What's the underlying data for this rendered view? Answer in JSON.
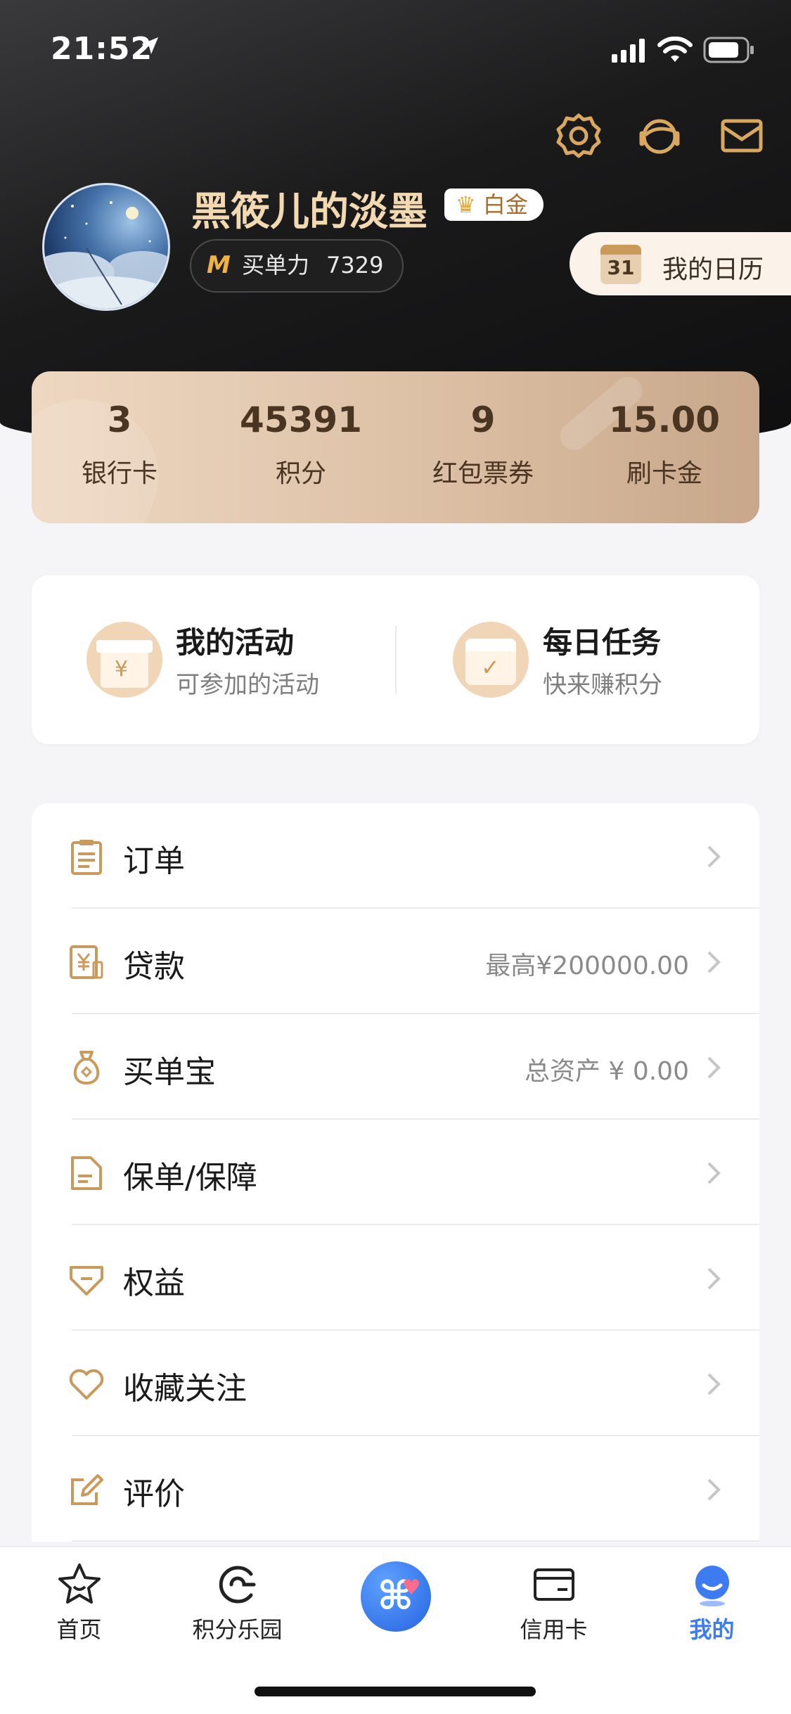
{
  "status_bar": {
    "time": "21:52"
  },
  "header": {
    "username": "黑筱儿的淡墨",
    "level_badge": "白金",
    "score_label": "买单力",
    "score_value": "7329",
    "calendar_day": "31",
    "calendar_label": "我的日历"
  },
  "stats": [
    {
      "value": "3",
      "label": "银行卡"
    },
    {
      "value": "45391",
      "label": "积分"
    },
    {
      "value": "9",
      "label": "红包票券"
    },
    {
      "value": "15.00",
      "label": "刷卡金"
    }
  ],
  "activity": {
    "left": {
      "title": "我的活动",
      "subtitle": "可参加的活动"
    },
    "right": {
      "title": "每日任务",
      "subtitle": "快来赚积分"
    }
  },
  "menu": [
    {
      "label": "订单",
      "value": "",
      "icon": "order-icon"
    },
    {
      "label": "贷款",
      "value": "最高¥200000.00",
      "icon": "loan-icon"
    },
    {
      "label": "买单宝",
      "value": "总资产 ¥ 0.00",
      "icon": "money-bag-icon"
    },
    {
      "label": "保单/保障",
      "value": "",
      "icon": "policy-icon"
    },
    {
      "label": "权益",
      "value": "",
      "icon": "diamond-icon"
    },
    {
      "label": "收藏关注",
      "value": "",
      "icon": "heart-icon"
    },
    {
      "label": "评价",
      "value": "",
      "icon": "edit-icon"
    }
  ],
  "tabs": [
    {
      "label": "首页",
      "icon": "star-icon",
      "active": false
    },
    {
      "label": "积分乐园",
      "icon": "points-icon",
      "active": false
    },
    {
      "label": "",
      "icon": "center-logo-icon",
      "active": false
    },
    {
      "label": "信用卡",
      "icon": "card-icon",
      "active": false
    },
    {
      "label": "我的",
      "icon": "profile-icon",
      "active": true
    }
  ],
  "colors": {
    "accent_gold": "#c99a5b",
    "active_tab": "#3c7bf0",
    "header_dark": "#121212"
  }
}
